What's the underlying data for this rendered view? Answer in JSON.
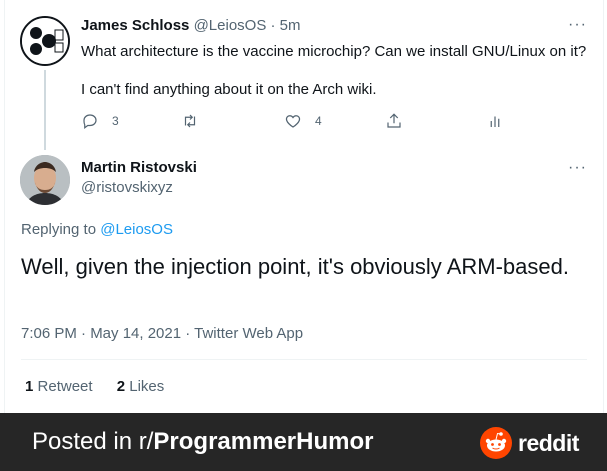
{
  "tweet1": {
    "name": "James Schloss",
    "handle": "@LeiosOS",
    "time": "· 5m",
    "more": "···",
    "line1": "What architecture is the vaccine microchip? Can we install GNU/Linux on it?",
    "line2": "I can't find anything about it on the Arch wiki.",
    "reply_count": "3",
    "like_count": "4"
  },
  "tweet2": {
    "name": "Martin Ristovski",
    "handle": "@ristovskixyz",
    "more": "···",
    "replying_prefix": "Replying to",
    "replying_handle": "@LeiosOS",
    "text": "Well, given the injection point, it's obviously ARM-based.",
    "meta": "7:06 PM · May 14, 2021 · Twitter Web App",
    "retweets_count": "1",
    "retweets_label": "Retweet",
    "likes_count": "2",
    "likes_label": "Likes"
  },
  "footer": {
    "posted_prefix": "Posted in r/",
    "subreddit": "ProgrammerHumor",
    "brand": "reddit"
  },
  "colors": {
    "link": "#1d9bf0",
    "muted": "#536471",
    "bar_bg": "#262626",
    "reddit_orange": "#ff4500"
  }
}
